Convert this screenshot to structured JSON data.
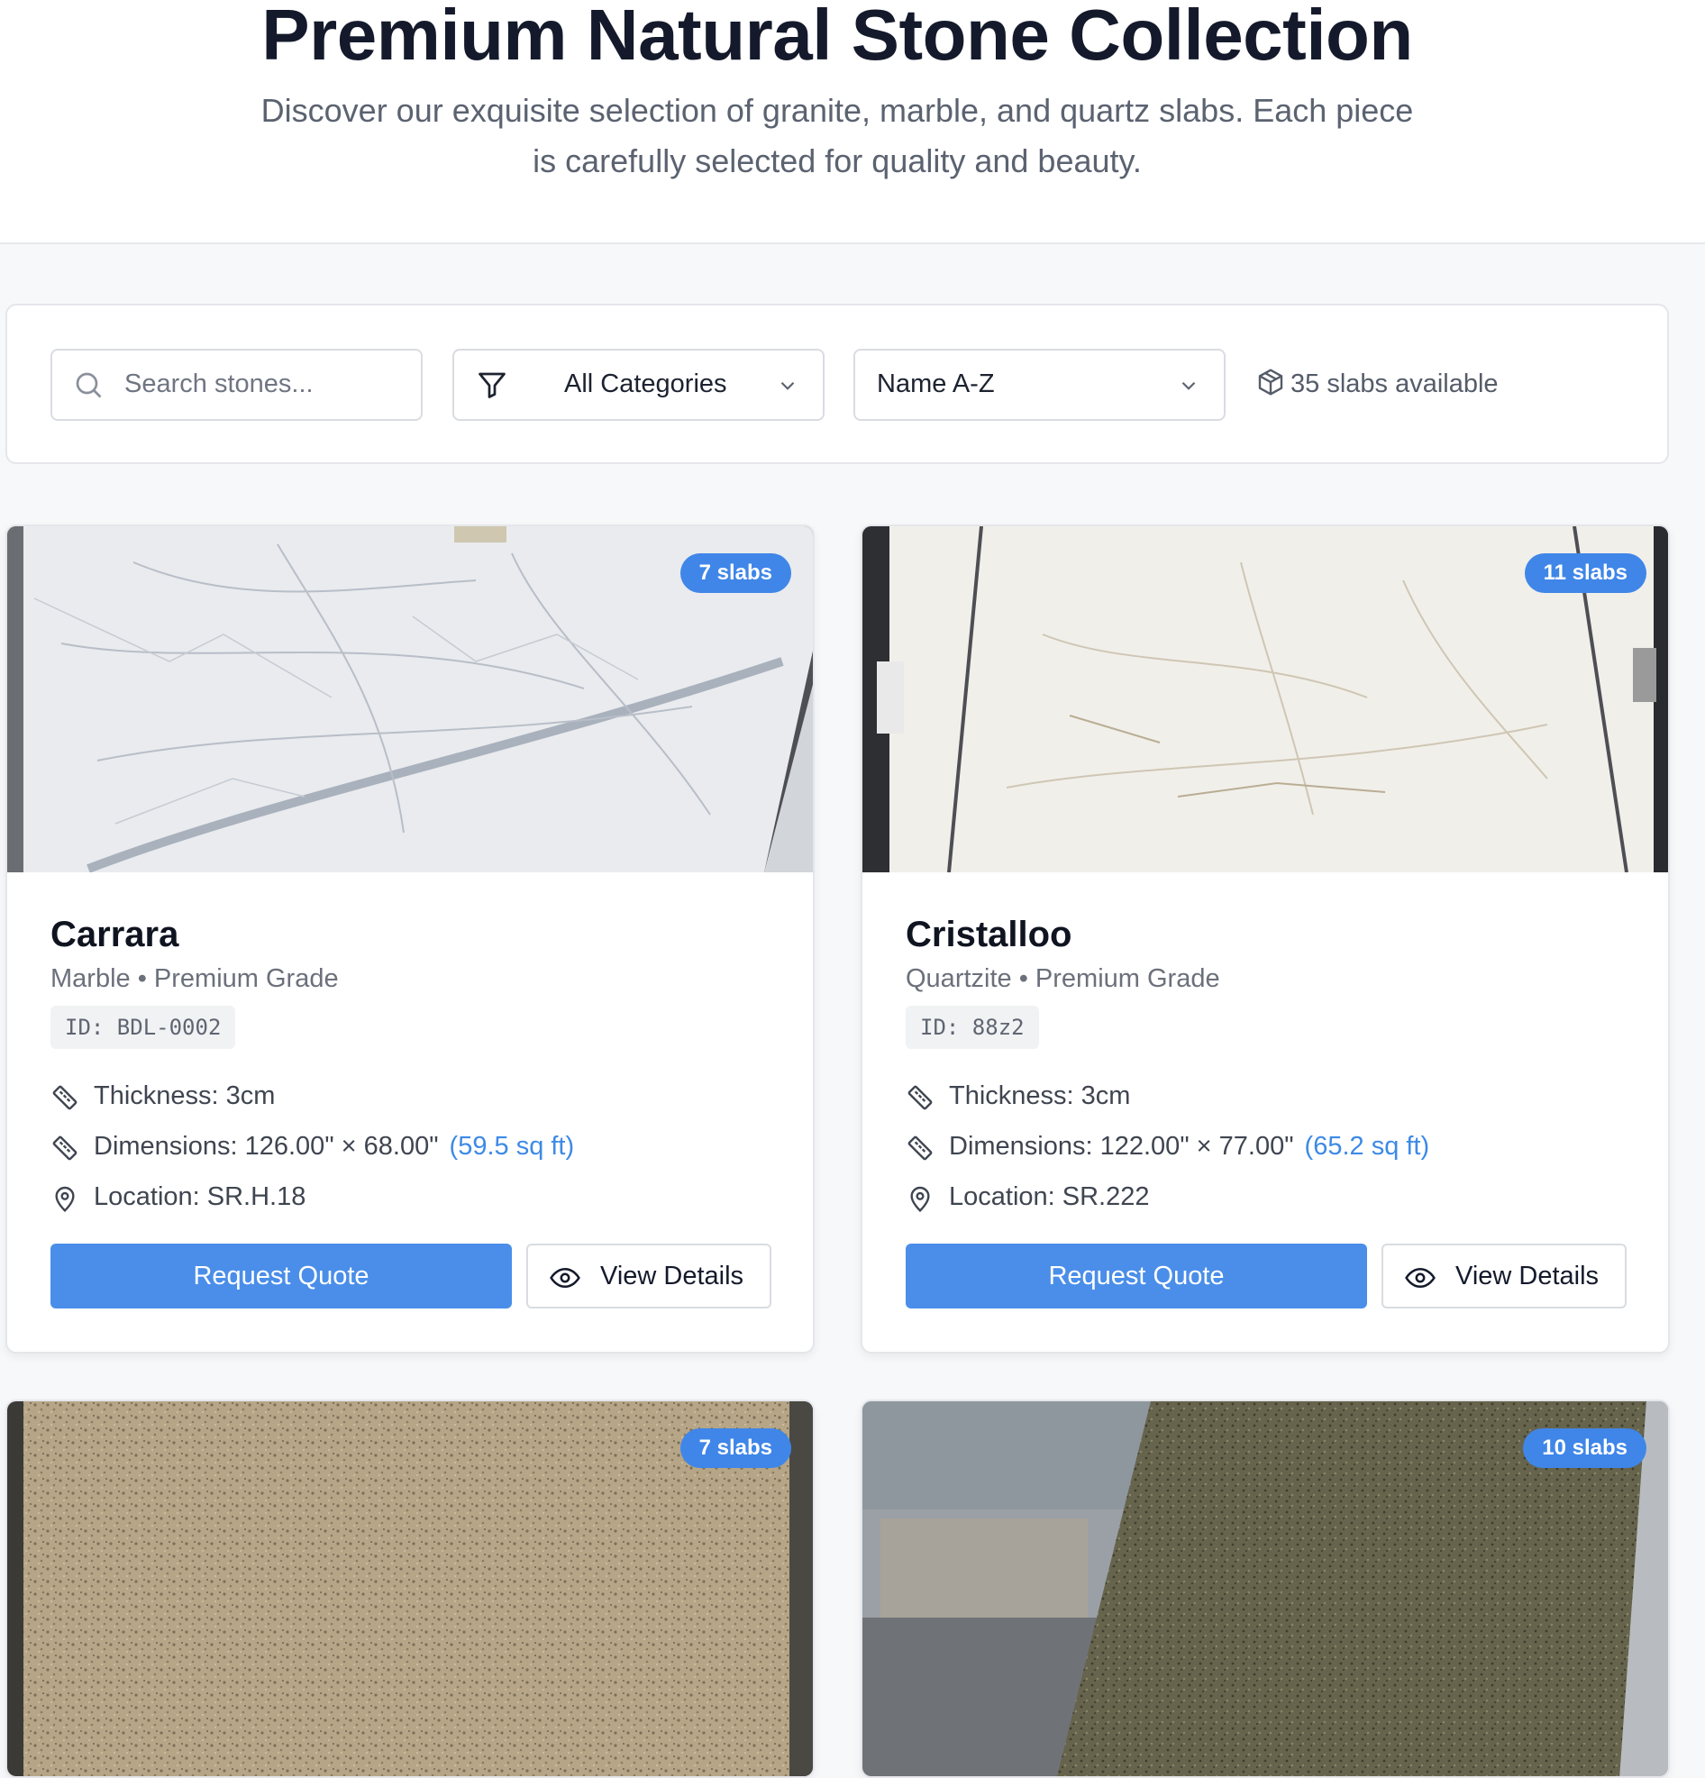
{
  "header": {
    "title": "Premium Natural Stone Collection",
    "subtitle": "Discover our exquisite selection of granite, marble, and quartz slabs. Each piece is carefully selected for quality and beauty."
  },
  "filters": {
    "search_placeholder": "Search stones...",
    "category": "All Categories",
    "sort": "Name A-Z",
    "available": "35 slabs available"
  },
  "buttons": {
    "quote": "Request Quote",
    "view": "View Details"
  },
  "cards": [
    {
      "badge": "7 slabs",
      "name": "Carrara",
      "subtitle": "Marble • Premium Grade",
      "id": "ID: BDL-0002",
      "thickness": "Thickness: 3cm",
      "dimensions": "Dimensions: 126.00\" × 68.00\"",
      "sqft": "(59.5 sq ft)",
      "location": "Location: SR.H.18",
      "colors": [
        "#e7e9ec",
        "#c9ced6"
      ]
    },
    {
      "badge": "11 slabs",
      "name": "Cristalloo",
      "subtitle": "Quartzite • Premium Grade",
      "id": "ID: 88z2",
      "thickness": "Thickness: 3cm",
      "dimensions": "Dimensions: 122.00\" × 77.00\"",
      "sqft": "(65.2 sq ft)",
      "location": "Location: SR.222",
      "colors": [
        "#f1efea",
        "#e1ddd4"
      ]
    },
    {
      "badge": "7 slabs",
      "colors": [
        "#b6a687",
        "#958467"
      ]
    },
    {
      "badge": "10 slabs",
      "colors": [
        "#6c6a52",
        "#4f4d3a"
      ]
    }
  ]
}
